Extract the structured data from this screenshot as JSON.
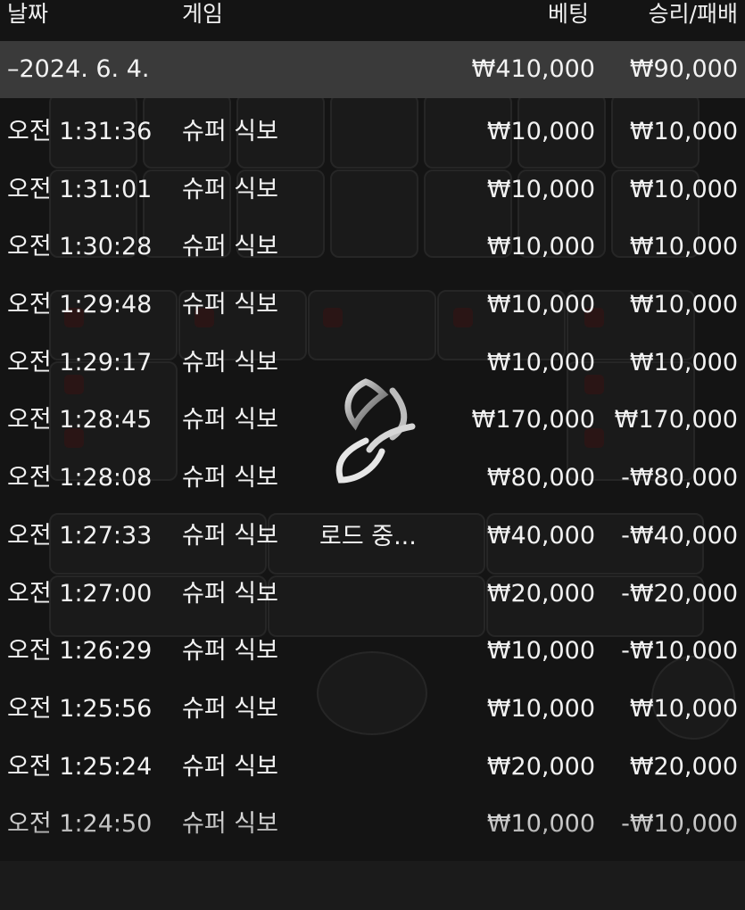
{
  "header": {
    "date_label": "날짜",
    "game_label": "게임",
    "bet_label": "베팅",
    "result_label": "승리/패배"
  },
  "summary": {
    "date": "–2024. 6. 4.",
    "total_bet": "₩410,000",
    "total_result": "₩90,000"
  },
  "rows": [
    {
      "time": "오전 1:31:36",
      "game": "슈퍼 식보",
      "bet": "₩10,000",
      "result": "₩10,000"
    },
    {
      "time": "오전 1:31:01",
      "game": "슈퍼 식보",
      "bet": "₩10,000",
      "result": "₩10,000"
    },
    {
      "time": "오전 1:30:28",
      "game": "슈퍼 식보",
      "bet": "₩10,000",
      "result": "₩10,000"
    },
    {
      "time": "오전 1:29:48",
      "game": "슈퍼 식보",
      "bet": "₩10,000",
      "result": "₩10,000"
    },
    {
      "time": "오전 1:29:17",
      "game": "슈퍼 식보",
      "bet": "₩10,000",
      "result": "₩10,000"
    },
    {
      "time": "오전 1:28:45",
      "game": "슈퍼 식보",
      "bet": "₩170,000",
      "result": "₩170,000"
    },
    {
      "time": "오전 1:28:08",
      "game": "슈퍼 식보",
      "bet": "₩80,000",
      "result": "-₩80,000"
    },
    {
      "time": "오전 1:27:33",
      "game": "슈퍼 식보",
      "bet": "₩40,000",
      "result": "-₩40,000"
    },
    {
      "time": "오전 1:27:00",
      "game": "슈퍼 식보",
      "bet": "₩20,000",
      "result": "-₩20,000"
    },
    {
      "time": "오전 1:26:29",
      "game": "슈퍼 식보",
      "bet": "₩10,000",
      "result": "-₩10,000"
    },
    {
      "time": "오전 1:25:56",
      "game": "슈퍼 식보",
      "bet": "₩10,000",
      "result": "₩10,000"
    },
    {
      "time": "오전 1:25:24",
      "game": "슈퍼 식보",
      "bet": "₩20,000",
      "result": "₩20,000"
    },
    {
      "time": "오전 1:24:50",
      "game": "슈퍼 식보",
      "bet": "₩10,000",
      "result": "-₩10,000"
    }
  ],
  "loading": {
    "text": "로드 중..."
  },
  "colors": {
    "background": "#141414",
    "summary_row": "#3a3a3a",
    "text": "#f2f2f2"
  },
  "icons": {
    "spinner": "loading-spinner-icon"
  }
}
